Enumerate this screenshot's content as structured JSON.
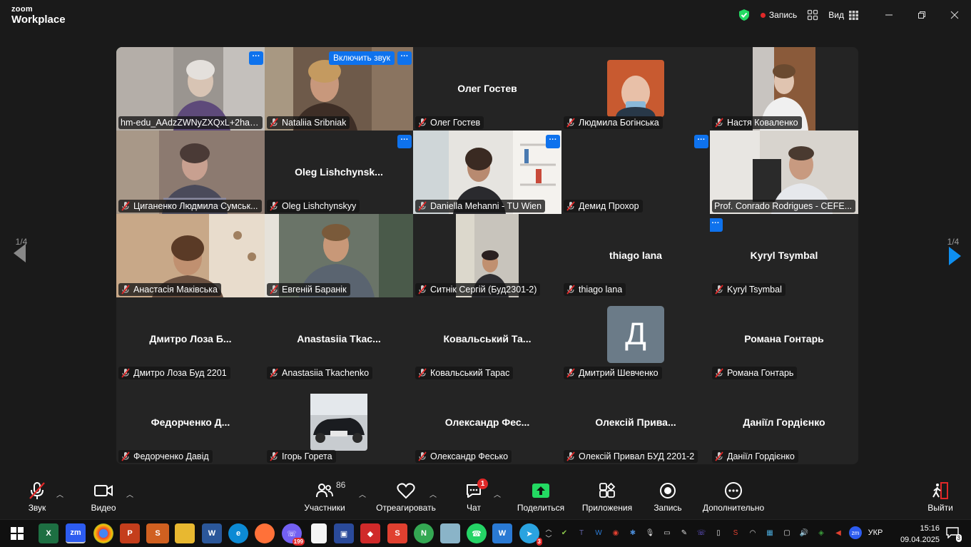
{
  "app": {
    "brand_small": "zoom",
    "brand_large": "Workplace"
  },
  "titlebar": {
    "recording_label": "Запись",
    "view_label": "Вид",
    "security_icon": "shield-check-icon"
  },
  "pager": {
    "left": "1/4",
    "right": "1/4"
  },
  "tiles": {
    "t1": {
      "name": "hm-edu_AAdzZWNyZXQxL+2hayf..."
    },
    "t2": {
      "name": "Nataliia Sribniak",
      "unmute": "Включить звук"
    },
    "t3": {
      "center": "Олег Гостев",
      "name": "Олег Гостев"
    },
    "t4": {
      "name": "Людмила Богінська"
    },
    "t5": {
      "name": "Настя Коваленко"
    },
    "t6": {
      "name": "Циганенко Людмила Сумськ..."
    },
    "t7": {
      "center": "Oleg Lishchynsk...",
      "name": "Oleg Lishchynskyy"
    },
    "t8": {
      "name": "Daniella Mehanni - TU Wien"
    },
    "t9": {
      "name": "Демид Прохор"
    },
    "t10": {
      "name": "Prof. Conrado Rodrigues - CEFE..."
    },
    "t11": {
      "name": "Анастасія Маківська"
    },
    "t12": {
      "name": "Евгеній Баранік"
    },
    "t13": {
      "name": "Ситнік Сергій (Буд2301-2)"
    },
    "t14": {
      "center": "thiago lana",
      "name": "thiago lana"
    },
    "t15": {
      "center": "Kyryl Tsymbal",
      "name": "Kyryl Tsymbal"
    },
    "t16": {
      "center": "Дмитро Лоза Б...",
      "name": "Дмитро Лоза Буд 2201"
    },
    "t17": {
      "center": "Anastasiia Tkac...",
      "name": "Anastasiia Tkachenko"
    },
    "t18": {
      "center": "Ковальський Та...",
      "name": "Ковальський Тарас"
    },
    "t19": {
      "avatar": "Д",
      "name": "Дмитрий Шевченко"
    },
    "t20": {
      "center": "Романа Гонтарь",
      "name": "Романа Гонтарь"
    },
    "t21": {
      "center": "Федорченко Д...",
      "name": "Федорченко Давід"
    },
    "t22": {
      "name": "Ігорь Горета"
    },
    "t23": {
      "center": "Олександр Фес...",
      "name": "Олександр Фесько"
    },
    "t24": {
      "center": "Олексій Прива...",
      "name": "Олексій Привал БУД 2201-2"
    },
    "t25": {
      "center": "Даніїл Гордієнко",
      "name": "Даніїл Гордієнко"
    }
  },
  "toolbar": {
    "audio": "Звук",
    "video": "Видео",
    "participants": "Участники",
    "participants_count": "86",
    "react": "Отреагировать",
    "chat": "Чат",
    "chat_badge": "1",
    "share": "Поделиться",
    "apps": "Приложения",
    "record": "Запись",
    "more": "Дополнительно",
    "leave": "Выйти"
  },
  "taskbar": {
    "viber_badge": "199",
    "telegram_badge": "3",
    "lang": "УКР",
    "time": "15:16",
    "date": "09.04.2025",
    "notif_count": "3",
    "zoom_tray": "zm"
  },
  "colors": {
    "accent_blue": "#0e72ed",
    "active_speaker": "#23d962",
    "share_green": "#23d962",
    "alert_red": "#e02828"
  }
}
